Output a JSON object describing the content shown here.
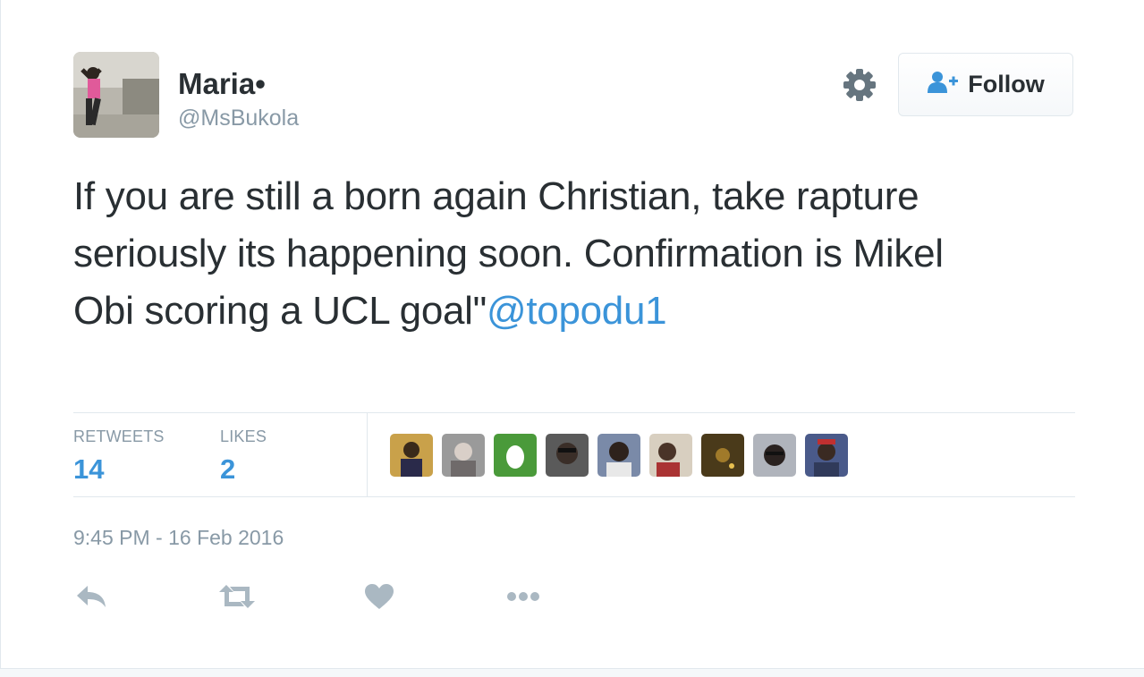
{
  "user": {
    "name": "Maria•",
    "handle": "@MsBukola"
  },
  "follow_button": {
    "label": "Follow"
  },
  "tweet": {
    "text": "If you are still a born again Christian, take rapture seriously its happening soon. Confirmation is Mikel Obi scoring a UCL goal\"",
    "mention": "@topodu1"
  },
  "stats": {
    "retweets_label": "RETWEETS",
    "retweets_count": "14",
    "likes_label": "LIKES",
    "likes_count": "2"
  },
  "timestamp": "9:45 PM - 16 Feb 2016",
  "actions": [
    "reply-icon",
    "retweet-icon",
    "like-icon",
    "more-icon"
  ],
  "colors": {
    "link": "#3b94d9",
    "muted": "#8899a6",
    "text": "#292f33",
    "icon": "#aab8c2"
  }
}
